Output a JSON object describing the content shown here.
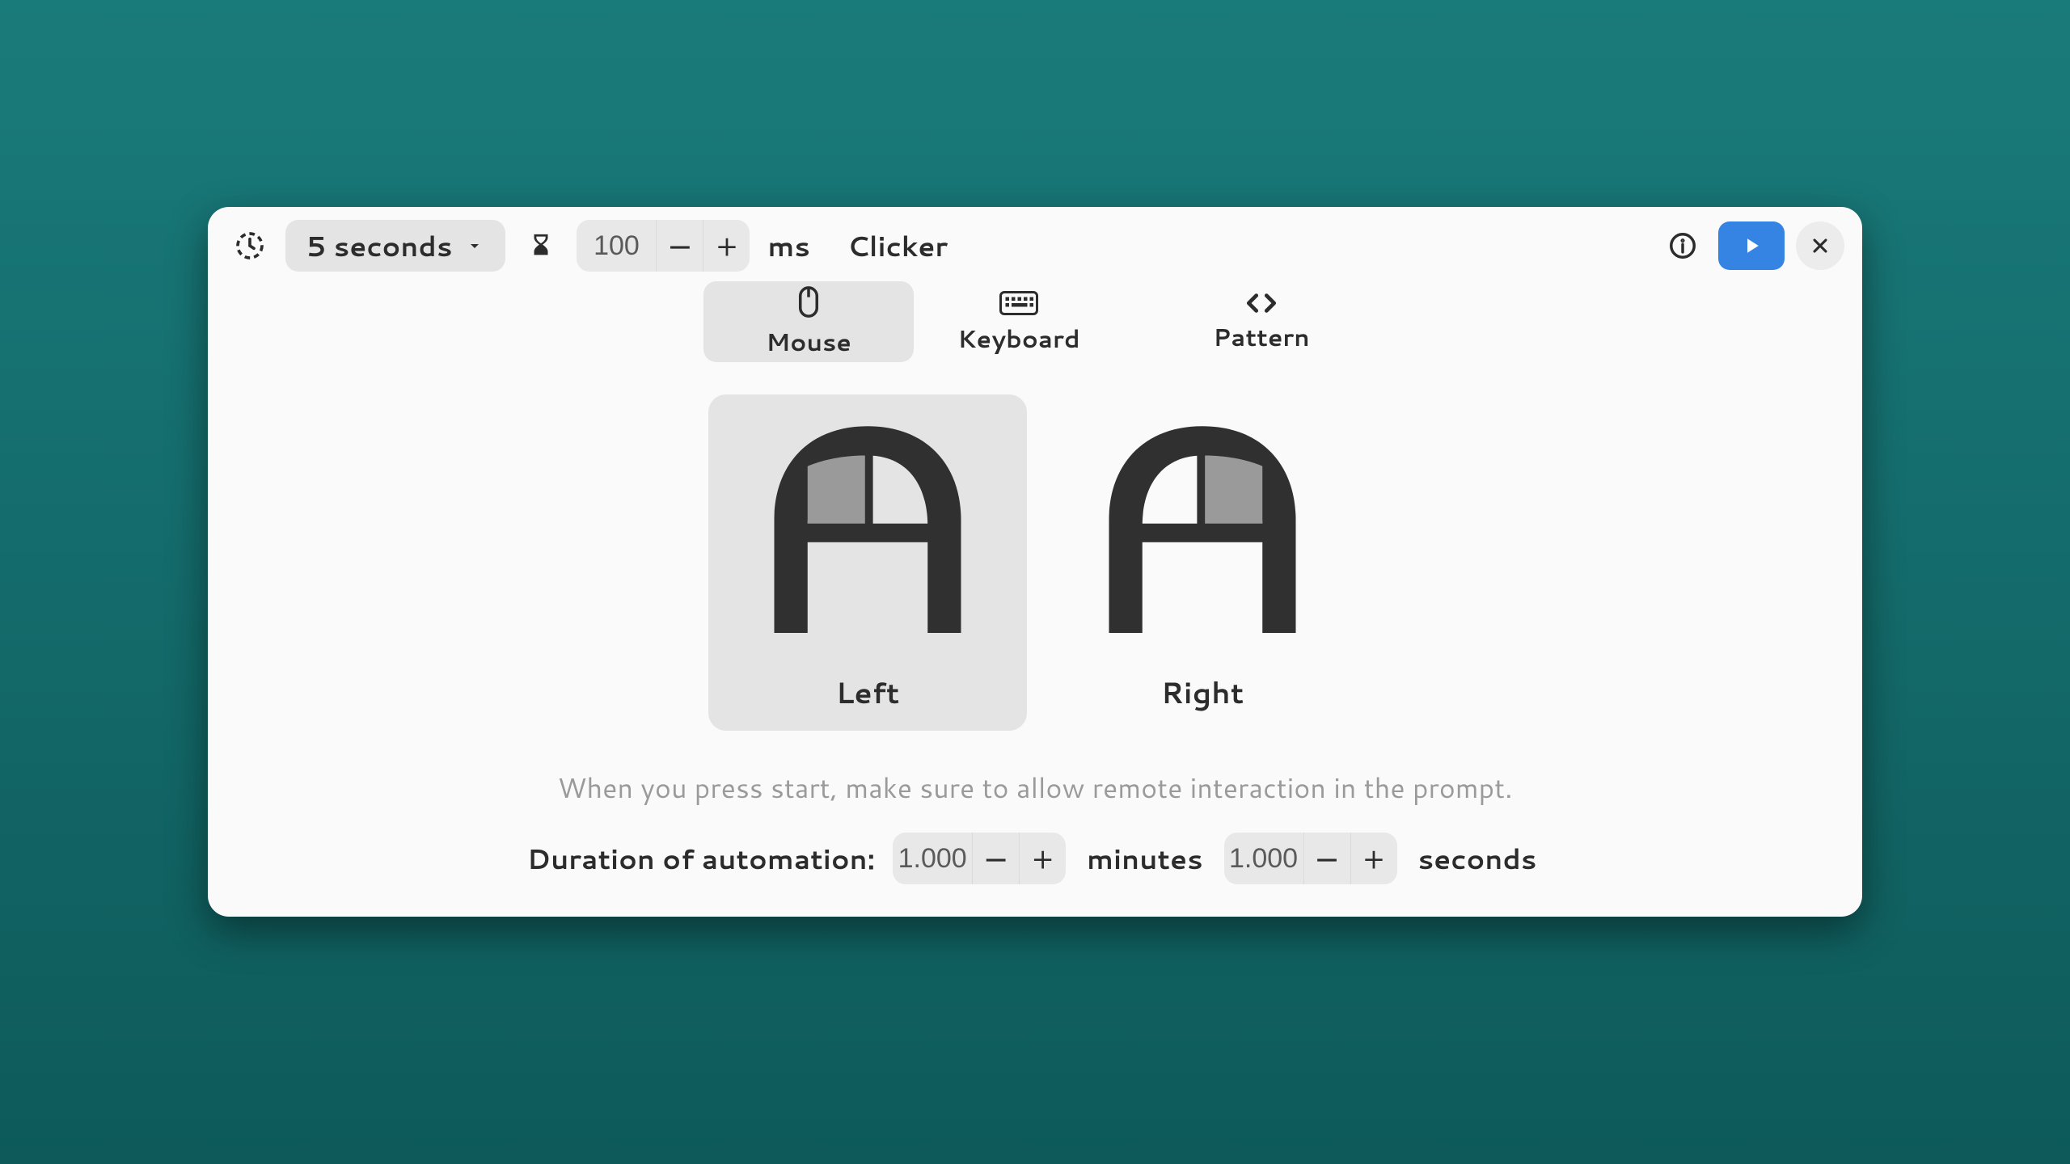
{
  "header": {
    "title": "Clicker",
    "delay_dropdown": "5 seconds",
    "interval_value": "100",
    "interval_unit": "ms"
  },
  "tabs": {
    "mouse": "Mouse",
    "keyboard": "Keyboard",
    "pattern": "Pattern"
  },
  "mouse": {
    "left": "Left",
    "right": "Right"
  },
  "hint": "When you press start, make sure to allow remote interaction in the prompt.",
  "duration": {
    "label": "Duration of automation:",
    "minutes_value": "1.000",
    "minutes_unit": "minutes",
    "seconds_value": "1.000",
    "seconds_unit": "seconds"
  }
}
